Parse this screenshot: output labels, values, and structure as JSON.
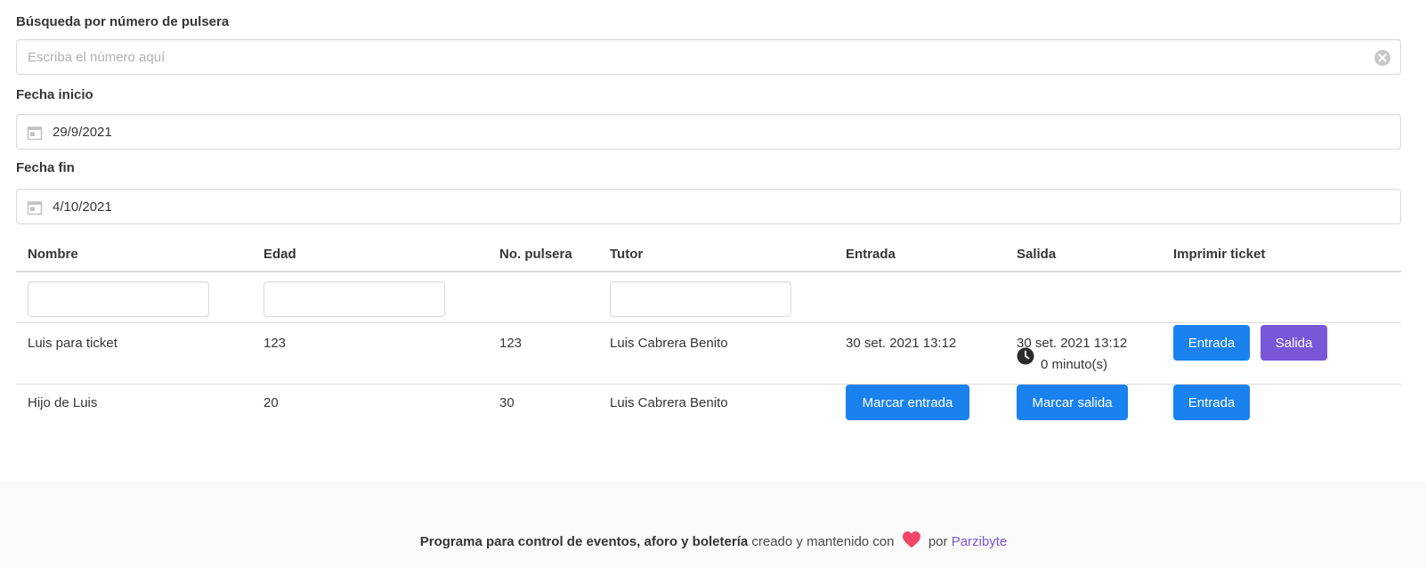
{
  "search": {
    "label": "Búsqueda por número de pulsera",
    "placeholder": "Escriba el número aquí",
    "clear_icon": "clear-circle-icon"
  },
  "date_start": {
    "label": "Fecha inicio",
    "value": "29/9/2021",
    "icon": "calendar-icon"
  },
  "date_end": {
    "label": "Fecha fin",
    "value": "4/10/2021",
    "icon": "calendar-icon"
  },
  "table": {
    "headers": [
      "Nombre",
      "Edad",
      "No. pulsera",
      "Tutor",
      "Entrada",
      "Salida",
      "Imprimir ticket"
    ],
    "rows": [
      {
        "nombre": "Luis para ticket",
        "edad": "123",
        "pulsera": "123",
        "tutor": "Luis Cabrera Benito",
        "entrada": "30 set. 2021 13:12",
        "salida": "30 set. 2021 13:12",
        "duracion": "0 minuto(s)",
        "ticket_buttons": [
          "Entrada",
          "Salida"
        ]
      },
      {
        "nombre": "Hijo de Luis",
        "edad": "20",
        "pulsera": "30",
        "tutor": "Luis Cabrera Benito",
        "entrada_button": "Marcar entrada",
        "salida_button": "Marcar salida",
        "ticket_buttons": [
          "Entrada"
        ]
      }
    ]
  },
  "footer": {
    "bold_text": "Programa para control de eventos, aforo y boletería",
    "text": "creado y mantenido con",
    "by": "por",
    "link": "Parzibyte"
  },
  "colors": {
    "primary": "#1a82ee",
    "purple": "#7a56d8",
    "heart": "#f14668"
  }
}
